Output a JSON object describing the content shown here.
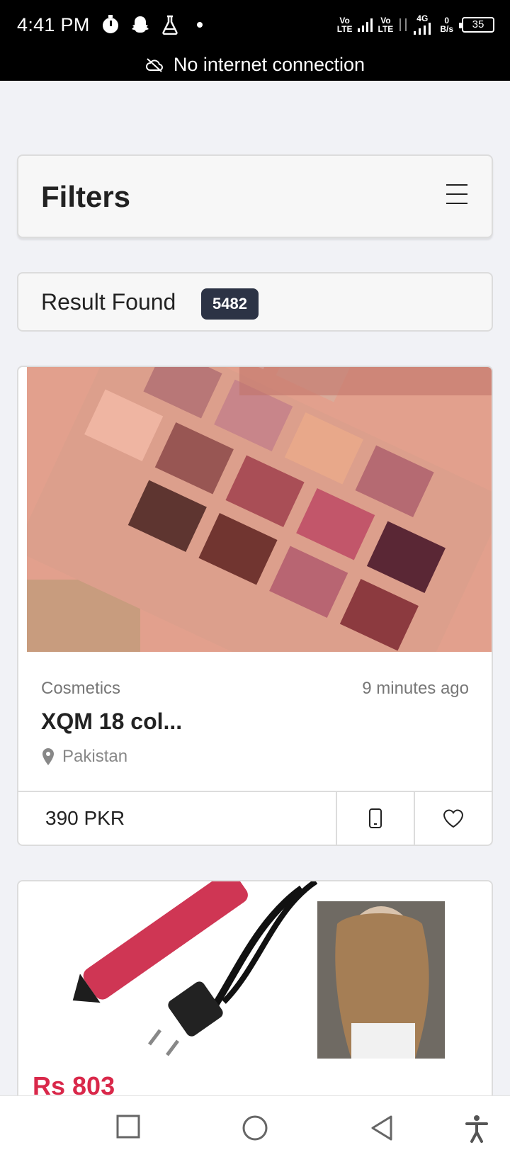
{
  "status_bar": {
    "time": "4:41 PM",
    "left_icons": [
      "timer-icon",
      "snapchat-icon",
      "flask-icon",
      "dot-icon"
    ],
    "sim1": [
      "Vo",
      "LTE"
    ],
    "sim2": [
      "Vo",
      "LTE"
    ],
    "network_type": "4G",
    "data_speed": [
      "0",
      "B/s"
    ],
    "battery": "35"
  },
  "network_banner": {
    "icon": "cloud-off-icon",
    "text": "No internet connection"
  },
  "filters": {
    "title": "Filters",
    "menu_icon": "hamburger-menu-icon"
  },
  "results": {
    "label": "Result Found",
    "count": "5482"
  },
  "products": [
    {
      "image": "eyeshadow-palette-photo",
      "category": "Cosmetics",
      "posted": "9 minutes ago",
      "title": "XQM 18 col...",
      "location": "Pakistan",
      "price": "390 PKR"
    },
    {
      "image": "hair-straightener-photo",
      "price_partial": "Rs 803"
    }
  ],
  "nav_bar": [
    "recents-square-icon",
    "home-circle-icon",
    "back-triangle-icon",
    "accessibility-icon"
  ],
  "colors": {
    "badge": "#2c3345",
    "background": "#f1f2f6",
    "status_bar": "#000000"
  }
}
